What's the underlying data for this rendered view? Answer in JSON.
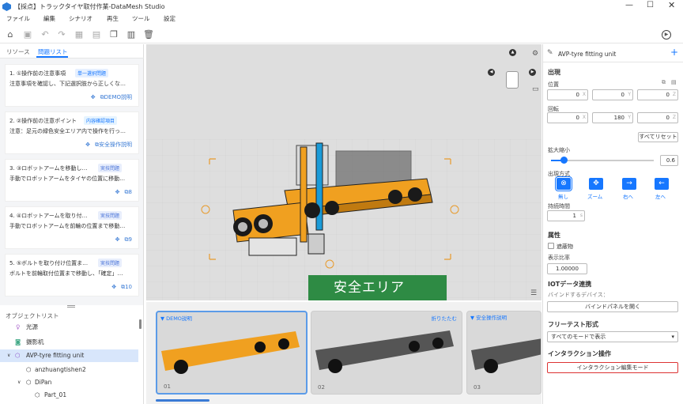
{
  "window": {
    "title": "【採点】トラックタイヤ取付作業-DataMesh Studio"
  },
  "menu": [
    "ファイル",
    "編集",
    "シナリオ",
    "再生",
    "ツール",
    "設定"
  ],
  "left": {
    "tabs": {
      "resources": "リソース",
      "questions": "問題リスト"
    },
    "questions": [
      {
        "title": "1. ①操作前の注意事項",
        "tag": "単一選択問題",
        "desc": "注意事項を確認し、下記選択肢から正しくな…",
        "action": "DEMO説明",
        "tag_color": "#1677ff",
        "tag_bg": "#e6f0ff"
      },
      {
        "title": "2. ②操作前の注意ポイント",
        "tag": "内容確認項目",
        "desc": "注意：足元の緑色安全エリア内で操作を行っ…",
        "action": "安全操作説明",
        "tag_color": "#1677ff",
        "tag_bg": "#e6f4ff"
      },
      {
        "title": "3. ③ロボットアームを移動し…",
        "tag": "実技問題",
        "desc": "手動でロボットアームをタイヤの位置に移動…",
        "action": "8",
        "tag_color": "#4a74d9",
        "tag_bg": "#e8eefc"
      },
      {
        "title": "4. ④ロボットアームを取り付…",
        "tag": "実技問題",
        "desc": "手動でロボットアームを前輪の位置まで移動…",
        "action": "9",
        "tag_color": "#4a74d9",
        "tag_bg": "#e8eefc"
      },
      {
        "title": "5. ⑤ボルトを取り付け位置ま…",
        "tag": "実技問題",
        "desc": "ボルトを前輪取付位置まで移動し、「確定」…",
        "action": "10",
        "tag_color": "#4a74d9",
        "tag_bg": "#e8eefc"
      }
    ],
    "object_list_title": "オブジェクトリスト",
    "tree": [
      {
        "label": "光源",
        "indent": 0,
        "icon": "bulb-icon"
      },
      {
        "label": "摄影机",
        "indent": 0,
        "icon": "camera-icon"
      },
      {
        "label": "AVP-tyre fitting unit",
        "indent": 0,
        "icon": "cube-icon",
        "selected": true
      },
      {
        "label": "anzhuangtishen2",
        "indent": 1,
        "icon": "cube-icon"
      },
      {
        "label": "DiPan",
        "indent": 1,
        "icon": "cube-icon"
      },
      {
        "label": "Part_01",
        "indent": 2,
        "icon": "cube-icon"
      }
    ]
  },
  "viewport": {
    "safe_area": "安全エリア"
  },
  "thumbs": [
    {
      "label": "DEMO説明",
      "num": "01",
      "right": ""
    },
    {
      "label": "",
      "num": "02",
      "right": "折りたたむ"
    },
    {
      "label": "安全操作説明",
      "num": "03",
      "right": ""
    }
  ],
  "right": {
    "title": "AVP-tyre fitting unit",
    "appear": "出現",
    "position": "位置",
    "pos": [
      "0",
      "0",
      "0"
    ],
    "rotation": "回転",
    "rot": [
      "0",
      "180",
      "0"
    ],
    "reset": "すべてリセット",
    "scale_label": "拡大縮小",
    "scale": "0.6",
    "scale_fraction": 0.12,
    "appear_mode": "出現方式",
    "modes": [
      "無し",
      "ズーム",
      "右へ",
      "左へ"
    ],
    "duration_label": "持続時間",
    "duration": "1",
    "attr": "属性",
    "occluder": "遮蔽物",
    "ratio_label": "表示比率",
    "ratio": "1.00000",
    "iot": "IOTデータ連携",
    "bind_device": "バインドするデバイス：",
    "open_bind": "バインドパネルを開く",
    "free_test": "フリーテスト形式",
    "free_mode": "すべてのモードで表示",
    "interaction": "インタラクション操作",
    "edit_mode": "インタラクション編集モード"
  },
  "colors": {
    "accent": "#1677ff",
    "safe_green": "#2e8b44",
    "frame_orange": "#f0a020",
    "highlight_red": "#d33"
  }
}
